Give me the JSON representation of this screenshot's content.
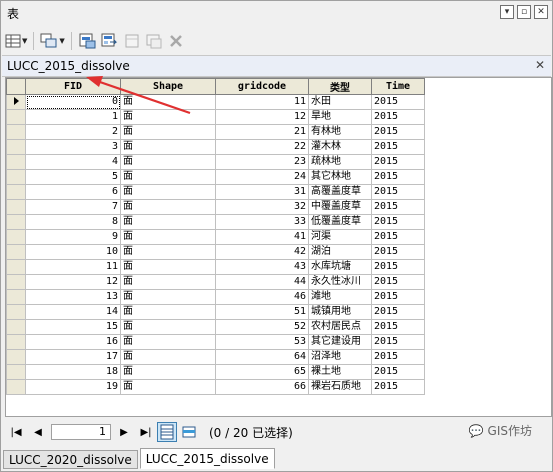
{
  "window": {
    "title": "表"
  },
  "table_name": "LUCC_2015_dissolve",
  "columns": {
    "fid": "FID",
    "shape": "Shape",
    "gridcode": "gridcode",
    "type": "类型",
    "time": "Time"
  },
  "rows": [
    {
      "fid": "0",
      "shape": "面",
      "gridcode": "11",
      "type": "水田",
      "time": "2015"
    },
    {
      "fid": "1",
      "shape": "面",
      "gridcode": "12",
      "type": "旱地",
      "time": "2015"
    },
    {
      "fid": "2",
      "shape": "面",
      "gridcode": "21",
      "type": "有林地",
      "time": "2015"
    },
    {
      "fid": "3",
      "shape": "面",
      "gridcode": "22",
      "type": "灌木林",
      "time": "2015"
    },
    {
      "fid": "4",
      "shape": "面",
      "gridcode": "23",
      "type": "疏林地",
      "time": "2015"
    },
    {
      "fid": "5",
      "shape": "面",
      "gridcode": "24",
      "type": "其它林地",
      "time": "2015"
    },
    {
      "fid": "6",
      "shape": "面",
      "gridcode": "31",
      "type": "高覆盖度草",
      "time": "2015"
    },
    {
      "fid": "7",
      "shape": "面",
      "gridcode": "32",
      "type": "中覆盖度草",
      "time": "2015"
    },
    {
      "fid": "8",
      "shape": "面",
      "gridcode": "33",
      "type": "低覆盖度草",
      "time": "2015"
    },
    {
      "fid": "9",
      "shape": "面",
      "gridcode": "41",
      "type": "河渠",
      "time": "2015"
    },
    {
      "fid": "10",
      "shape": "面",
      "gridcode": "42",
      "type": "湖泊",
      "time": "2015"
    },
    {
      "fid": "11",
      "shape": "面",
      "gridcode": "43",
      "type": "水库坑塘",
      "time": "2015"
    },
    {
      "fid": "12",
      "shape": "面",
      "gridcode": "44",
      "type": "永久性冰川",
      "time": "2015"
    },
    {
      "fid": "13",
      "shape": "面",
      "gridcode": "46",
      "type": "滩地",
      "time": "2015"
    },
    {
      "fid": "14",
      "shape": "面",
      "gridcode": "51",
      "type": "城镇用地",
      "time": "2015"
    },
    {
      "fid": "15",
      "shape": "面",
      "gridcode": "52",
      "type": "农村居民点",
      "time": "2015"
    },
    {
      "fid": "16",
      "shape": "面",
      "gridcode": "53",
      "type": "其它建设用",
      "time": "2015"
    },
    {
      "fid": "17",
      "shape": "面",
      "gridcode": "64",
      "type": "沼泽地",
      "time": "2015"
    },
    {
      "fid": "18",
      "shape": "面",
      "gridcode": "65",
      "type": "裸土地",
      "time": "2015"
    },
    {
      "fid": "19",
      "shape": "面",
      "gridcode": "66",
      "type": "裸岩石质地",
      "time": "2015"
    }
  ],
  "nav": {
    "current_record": "1",
    "selection_info": "(0 / 20 已选择)"
  },
  "watermark": "GIS作坊",
  "bottom_tabs": [
    "LUCC_2020_dissolve",
    "LUCC_2015_dissolve"
  ],
  "colors": {
    "annotation_arrow": "#e03030",
    "header_bg": "#ece9d8",
    "active_view": "#cde6f7"
  }
}
